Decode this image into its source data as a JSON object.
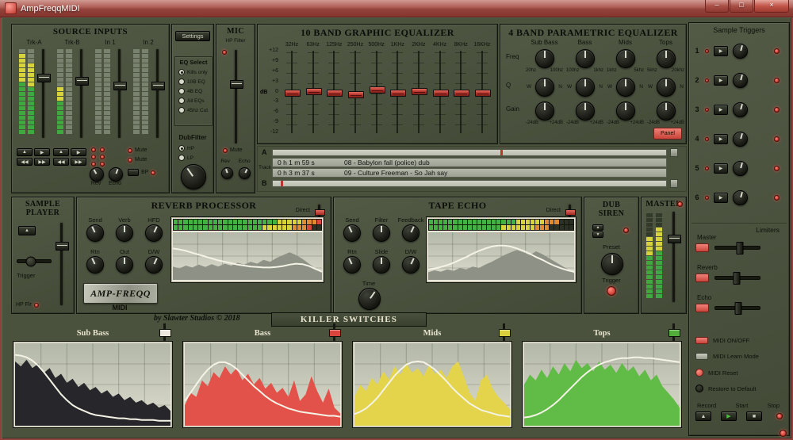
{
  "window": {
    "title": "AmpFreqqMIDI",
    "minimize_icon": "–",
    "maximize_icon": "□",
    "close_icon": "×"
  },
  "source_inputs": {
    "title": "SOURCE INPUTS",
    "channels": [
      {
        "name": "Trk-A",
        "meters": [
          [
            11,
            6
          ],
          [
            10,
            5
          ]
        ],
        "fader": 0.3
      },
      {
        "name": "Trk-B",
        "meters": [
          [
            7,
            3
          ],
          [
            0,
            0
          ]
        ],
        "fader": 0.34
      },
      {
        "name": "In 1",
        "meters": [
          [
            0,
            0
          ],
          [
            0,
            0
          ]
        ],
        "fader": 0.4
      },
      {
        "name": "In 2",
        "meters": [
          [
            0,
            0
          ],
          [
            0,
            0
          ]
        ],
        "fader": 0.4
      }
    ],
    "transport_icons": [
      "▲",
      "▶",
      "◀◀",
      "▶▶"
    ],
    "mute_label": "Mute",
    "rev_label": "Rev",
    "echo_label": "Echo",
    "bp_label": "BP"
  },
  "settings_panel": {
    "button_label": "Settings",
    "eq_select_title": "EQ Select",
    "eq_options": [
      "Kills only",
      "10B EQ",
      "4B EQ",
      "All EQs",
      "45hz Cut"
    ],
    "selected_index": 0,
    "dubfilter_title": "DubFilter",
    "dubfilter_options": [
      "HP",
      "LP"
    ],
    "dubfilter_selected": 0
  },
  "mic": {
    "title": "MIC",
    "hp_filter_label": "HP Filter",
    "mute_label": "Mute",
    "rev_label": "Rev",
    "echo_label": "Echo"
  },
  "graphic_eq": {
    "title": "10 BAND GRAPHIC EQUALIZER",
    "bands": [
      "32Hz",
      "63Hz",
      "125Hz",
      "250Hz",
      "500Hz",
      "1KHz",
      "2KHz",
      "4KHz",
      "8KHz",
      "16KHz"
    ],
    "scale": [
      "+12",
      "+9",
      "+6",
      "+3",
      "0",
      "-3",
      "-6",
      "-9",
      "-12"
    ],
    "db_label": "dB",
    "values_db": [
      0,
      0.5,
      0,
      -0.5,
      1,
      0,
      0.5,
      0,
      0,
      0
    ]
  },
  "parametric_eq": {
    "title": "4 BAND PARAMETRIC EQUALIZER",
    "row_labels": [
      "Freq",
      "Q",
      "Gain"
    ],
    "bands": [
      {
        "name": "Sub Bass",
        "freq_lo": "20hz",
        "freq_hi": "100hz"
      },
      {
        "name": "Bass",
        "freq_lo": "100hz",
        "freq_hi": "1khz"
      },
      {
        "name": "Mids",
        "freq_lo": "1khz",
        "freq_hi": "5khz"
      },
      {
        "name": "Tops",
        "freq_lo": "5khz",
        "freq_hi": "20khz"
      }
    ],
    "q_left": "W",
    "q_right": "N",
    "gain_lo": "-24dB",
    "gain_hi": "+24dB",
    "panel_label": "Panel"
  },
  "track_player": {
    "a_label": "A",
    "b_label": "B",
    "track_label": "Track",
    "tracks": [
      {
        "time": "0 h 1 m 59 s",
        "title": "08 - Babylon fall (police) dub",
        "position": 0.58
      },
      {
        "time": "0 h 3 m 37 s",
        "title": "09 - Culture Freeman - So Jah say",
        "position": 0.02
      }
    ]
  },
  "sample_player": {
    "title": "SAMPLE PLAYER",
    "trigger_label": "Trigger",
    "hp_label": "HP Flr",
    "eject_icon": "▲"
  },
  "reverb": {
    "title": "REVERB PROCESSOR",
    "direct_label": "Direct",
    "knob_labels": [
      [
        "Send",
        "Verb",
        "HFD"
      ],
      [
        "Rtn",
        "Out",
        "D/W"
      ]
    ],
    "logo": "AMP-FREQQ",
    "midi_label": "MIDI",
    "led_counts": [
      21,
      5,
      3,
      1
    ],
    "spectrum": [
      0.28,
      0.24,
      0.3,
      0.26,
      0.32,
      0.27,
      0.33,
      0.28,
      0.34,
      0.3,
      0.36,
      0.32,
      0.38,
      0.34,
      0.42,
      0.38,
      0.46,
      0.52,
      0.58,
      0.52,
      0.44,
      0.34,
      0.24,
      0.16
    ],
    "curve": [
      0.66,
      0.64,
      0.61,
      0.57,
      0.53,
      0.49,
      0.45,
      0.41,
      0.38,
      0.35,
      0.32,
      0.3,
      0.28,
      0.27,
      0.26,
      0.26,
      0.27,
      0.29,
      0.32,
      0.34,
      0.33,
      0.29,
      0.23,
      0.17
    ]
  },
  "tape_echo": {
    "title": "TAPE ECHO",
    "direct_label": "Direct",
    "knob_labels": [
      [
        "Send",
        "Filter",
        "Feedback"
      ],
      [
        "Rtn",
        "Slide",
        "D/W"
      ]
    ],
    "time_label": "Time",
    "led_counts": [
      18,
      6,
      3,
      0
    ],
    "spectrum": [
      0.16,
      0.2,
      0.17,
      0.22,
      0.19,
      0.25,
      0.22,
      0.28,
      0.25,
      0.32,
      0.38,
      0.45,
      0.52,
      0.58,
      0.63,
      0.58,
      0.52,
      0.6,
      0.54,
      0.46,
      0.38,
      0.3,
      0.22,
      0.14
    ],
    "curve": [
      0.22,
      0.24,
      0.27,
      0.31,
      0.36,
      0.42,
      0.48,
      0.55,
      0.61,
      0.66,
      0.7,
      0.72,
      0.72,
      0.7,
      0.66,
      0.61,
      0.55,
      0.48,
      0.42,
      0.35,
      0.29,
      0.24,
      0.2,
      0.17
    ]
  },
  "dub_siren": {
    "title": "DUB SIREN",
    "preset_label": "Preset",
    "trigger_label": "Trigger",
    "spinner_icons": [
      "▲",
      "▼"
    ]
  },
  "master": {
    "title": "MASTER",
    "meters": [
      [
        9,
        4
      ],
      [
        10,
        5
      ]
    ],
    "fader": 0.28
  },
  "sample_triggers": {
    "title": "Sample Triggers",
    "rows": [
      {
        "num": "1"
      },
      {
        "num": "2"
      },
      {
        "num": "3"
      },
      {
        "num": "4"
      },
      {
        "num": "5"
      },
      {
        "num": "6"
      }
    ],
    "button_icon": "▶"
  },
  "limiters": {
    "title": "Limiters",
    "items": [
      {
        "label": "Master",
        "value": 0.55
      },
      {
        "label": "Reverb",
        "value": 0.45
      },
      {
        "label": "Echo",
        "value": 0.5
      }
    ]
  },
  "midi_controls": {
    "items": [
      {
        "label": "MIDI ON/OFF",
        "indicator": "pill-red"
      },
      {
        "label": "MIDI Learn Mode",
        "indicator": "pill-gray"
      },
      {
        "label": "MIDI Reset",
        "indicator": "round-red"
      },
      {
        "label": "Restore to Default",
        "indicator": "round-dark"
      }
    ]
  },
  "recorder": {
    "labels": [
      "Record",
      "Start",
      "Stop"
    ],
    "button_icons": [
      "▲",
      "▶",
      "■"
    ]
  },
  "credit": "by Slawter Studios © 2018",
  "killer_switches": {
    "title": "KILLER SWITCHES",
    "panels": [
      {
        "name": "Sub Bass",
        "fill": "#26262b",
        "handle": "#ece9dc",
        "spectrum": [
          0.78,
          0.72,
          0.8,
          0.7,
          0.75,
          0.64,
          0.7,
          0.58,
          0.63,
          0.52,
          0.57,
          0.47,
          0.52,
          0.43,
          0.47,
          0.39,
          0.43,
          0.35,
          0.39,
          0.31,
          0.35,
          0.28,
          0.31,
          0.25,
          0.28,
          0.22,
          0.25,
          0.18
        ],
        "curve": [
          0.86,
          0.85,
          0.83,
          0.79,
          0.73,
          0.65,
          0.56,
          0.47,
          0.38,
          0.31,
          0.25,
          0.21,
          0.18,
          0.15,
          0.13,
          0.12,
          0.11,
          0.1,
          0.09,
          0.09,
          0.08,
          0.08,
          0.07,
          0.07,
          0.07,
          0.06,
          0.06,
          0.06
        ]
      },
      {
        "name": "Bass",
        "fill": "#e2524a",
        "handle": "#d8453d",
        "spectrum": [
          0.25,
          0.4,
          0.35,
          0.55,
          0.48,
          0.65,
          0.58,
          0.72,
          0.62,
          0.7,
          0.55,
          0.63,
          0.5,
          0.58,
          0.45,
          0.52,
          0.4,
          0.46,
          0.35,
          0.55,
          0.3,
          0.38,
          0.6,
          0.42,
          0.28,
          0.45,
          0.22,
          0.15
        ],
        "curve": [
          0.3,
          0.4,
          0.5,
          0.6,
          0.68,
          0.74,
          0.77,
          0.77,
          0.74,
          0.69,
          0.62,
          0.55,
          0.48,
          0.42,
          0.36,
          0.31,
          0.27,
          0.24,
          0.21,
          0.19,
          0.17,
          0.16,
          0.15,
          0.14,
          0.13,
          0.12,
          0.12,
          0.11
        ]
      },
      {
        "name": "Mids",
        "fill": "#e3d44c",
        "handle": "#d9cf3c",
        "spectrum": [
          0.35,
          0.5,
          0.42,
          0.58,
          0.5,
          0.66,
          0.56,
          0.72,
          0.62,
          0.76,
          0.64,
          0.7,
          0.6,
          0.74,
          0.63,
          0.68,
          0.58,
          0.72,
          0.78,
          0.6,
          0.4,
          0.3,
          0.55,
          0.62,
          0.45,
          0.35,
          0.28,
          0.2
        ],
        "curve": [
          0.14,
          0.17,
          0.21,
          0.27,
          0.34,
          0.43,
          0.52,
          0.61,
          0.68,
          0.74,
          0.77,
          0.78,
          0.77,
          0.73,
          0.68,
          0.61,
          0.54,
          0.46,
          0.39,
          0.33,
          0.27,
          0.23,
          0.19,
          0.17,
          0.15,
          0.13,
          0.12,
          0.11
        ]
      },
      {
        "name": "Tops",
        "fill": "#61bb47",
        "handle": "#52ad3a",
        "spectrum": [
          0.5,
          0.62,
          0.55,
          0.68,
          0.58,
          0.72,
          0.62,
          0.76,
          0.66,
          0.8,
          0.7,
          0.76,
          0.66,
          0.78,
          0.68,
          0.74,
          0.64,
          0.76,
          0.66,
          0.72,
          0.6,
          0.68,
          0.55,
          0.62,
          0.48,
          0.4,
          0.32,
          0.22
        ],
        "curve": [
          0.1,
          0.11,
          0.13,
          0.16,
          0.2,
          0.25,
          0.31,
          0.38,
          0.45,
          0.52,
          0.59,
          0.65,
          0.7,
          0.74,
          0.77,
          0.79,
          0.81,
          0.82,
          0.82,
          0.83,
          0.83,
          0.82,
          0.82,
          0.81,
          0.8,
          0.79,
          0.78,
          0.77
        ]
      }
    ]
  }
}
